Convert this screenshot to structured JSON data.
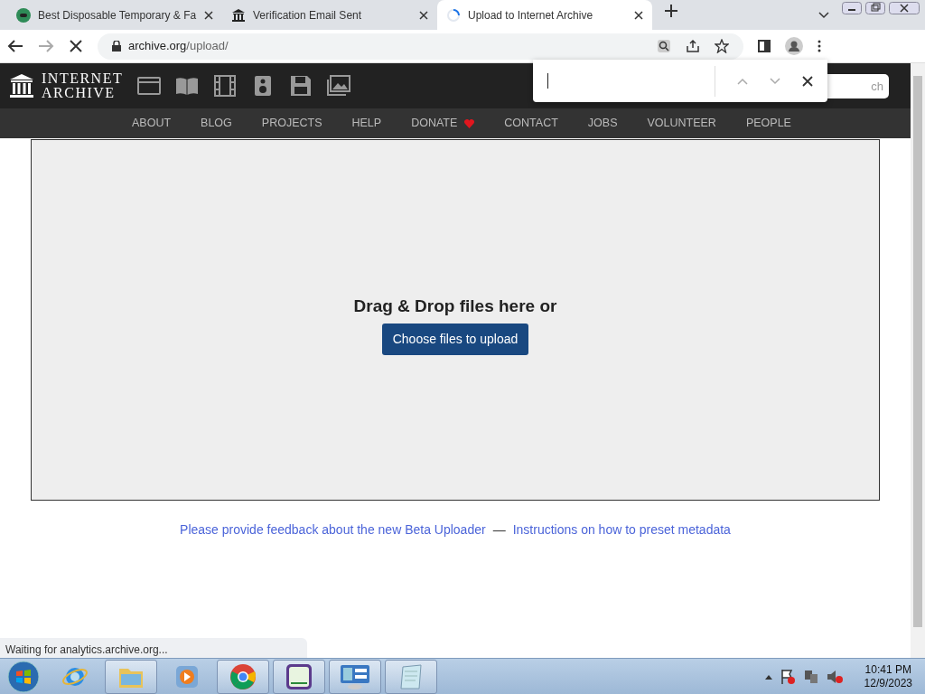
{
  "tabs": [
    {
      "title": "Best Disposable Temporary & Fa",
      "kind": "chat",
      "selected": false
    },
    {
      "title": "Verification Email Sent",
      "kind": "temple",
      "selected": false
    },
    {
      "title": "Upload to Internet Archive",
      "kind": "spinner",
      "selected": true
    }
  ],
  "address": {
    "host": "archive.org",
    "path": "/upload/"
  },
  "site": {
    "logo_lines": [
      "INTERNET",
      "ARCHIVE"
    ],
    "search_placeholder": "ch",
    "nav": [
      {
        "label": "ABOUT"
      },
      {
        "label": "BLOG"
      },
      {
        "label": "PROJECTS"
      },
      {
        "label": "HELP"
      },
      {
        "label": "DONATE",
        "heart": true
      },
      {
        "label": "CONTACT"
      },
      {
        "label": "JOBS"
      },
      {
        "label": "VOLUNTEER"
      },
      {
        "label": "PEOPLE"
      }
    ]
  },
  "dropzone": {
    "heading": "Drag & Drop files here or",
    "button": "Choose files to upload"
  },
  "footer_links": [
    {
      "text": "Please provide feedback about the new Beta Uploader"
    },
    {
      "text": "Instructions on how to preset metadata"
    }
  ],
  "separator": "—",
  "status": "Waiting for analytics.archive.org...",
  "taskbar": [
    {
      "kind": "ie",
      "running": false
    },
    {
      "kind": "folder",
      "running": true
    },
    {
      "kind": "media",
      "running": false
    },
    {
      "kind": "chrome",
      "running": true
    },
    {
      "kind": "wii",
      "running": true
    },
    {
      "kind": "panel",
      "running": true
    },
    {
      "kind": "notepad",
      "running": true
    }
  ],
  "clock": {
    "time": "10:41 PM",
    "date": "12/9/2023"
  }
}
